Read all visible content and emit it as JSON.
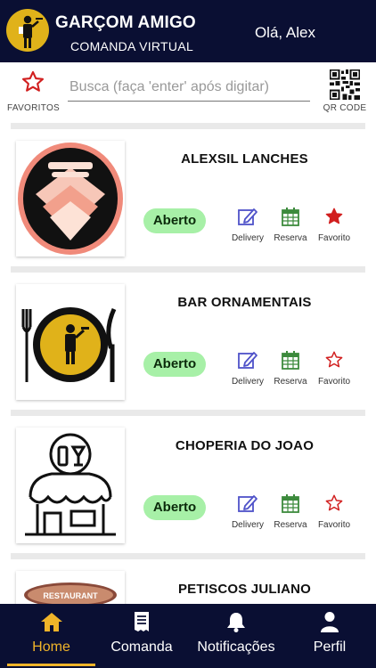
{
  "header": {
    "app_title": "GARÇOM AMIGO",
    "app_subtitle": "COMANDA VIRTUAL",
    "greeting": "Olá, Alex",
    "logo_icon": "waiter-logo-icon",
    "logo_color": "#e0b21a",
    "background": "#0a0f33"
  },
  "toolbar": {
    "favorites_label": "FAVORITOS",
    "search_placeholder": "Busca (faça 'enter' após digitar)",
    "search_value": "",
    "qr_label": "QR CODE"
  },
  "restaurants": [
    {
      "name": "ALEXSIL LANCHES",
      "status": "Aberto",
      "favorited": true,
      "actions": {
        "delivery": "Delivery",
        "reserva": "Reserva",
        "favorito": "Favorito"
      }
    },
    {
      "name": "BAR ORNAMENTAIS",
      "status": "Aberto",
      "favorited": false,
      "actions": {
        "delivery": "Delivery",
        "reserva": "Reserva",
        "favorito": "Favorito"
      }
    },
    {
      "name": "CHOPERIA DO JOAO",
      "status": "Aberto",
      "favorited": false,
      "actions": {
        "delivery": "Delivery",
        "reserva": "Reserva",
        "favorito": "Favorito"
      }
    },
    {
      "name": "PETISCOS JULIANO",
      "thumb_text": "RESTAURANT"
    }
  ],
  "nav": {
    "items": [
      {
        "label": "Home",
        "icon": "home-icon",
        "active": true
      },
      {
        "label": "Comanda",
        "icon": "receipt-icon",
        "active": false
      },
      {
        "label": "Notificações",
        "icon": "bell-icon",
        "active": false
      },
      {
        "label": "Perfil",
        "icon": "user-icon",
        "active": false
      }
    ]
  },
  "colors": {
    "accent": "#f0b429",
    "status_open_bg": "#a7f0a7",
    "star_red": "#d11f1f",
    "edit_blue": "#4f52c9",
    "calendar_green": "#3c8a3c"
  }
}
